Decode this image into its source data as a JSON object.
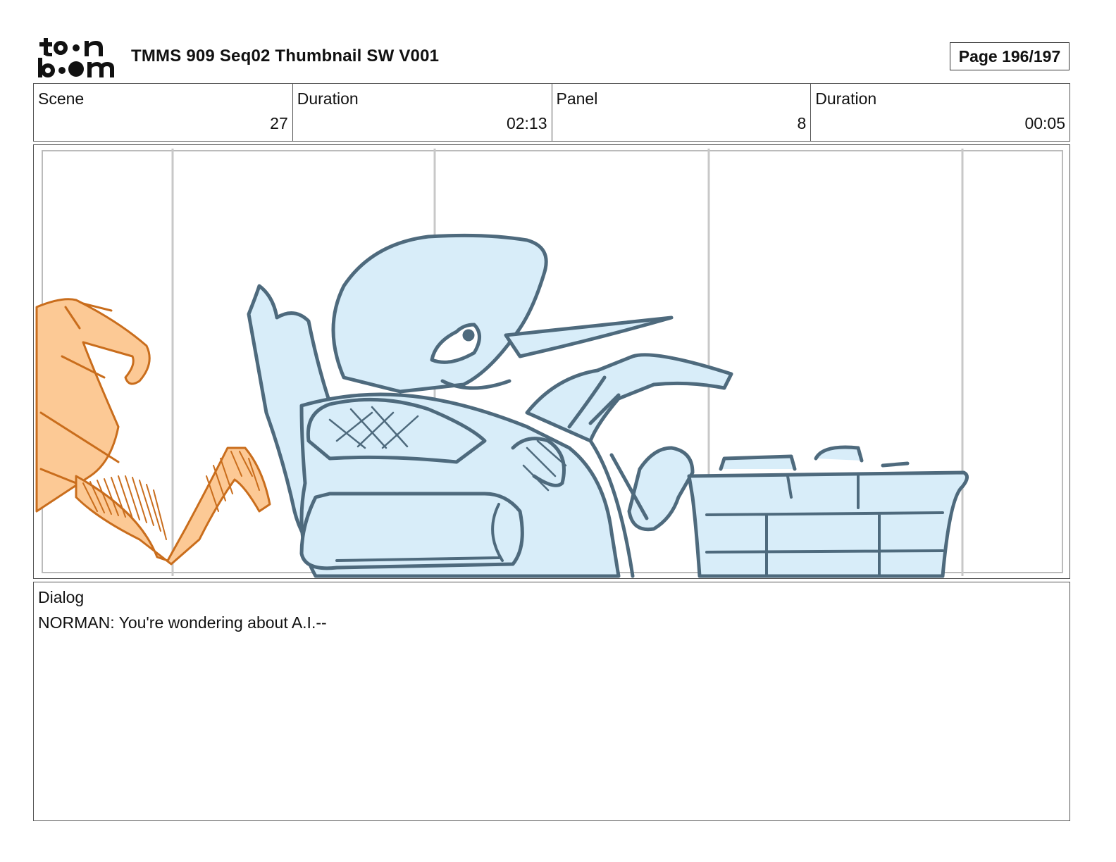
{
  "header": {
    "logo_text": "toonboom",
    "title": "TMMS 909 Seq02 Thumbnail SW V001",
    "page": "Page 196/197"
  },
  "info": {
    "scene_label": "Scene",
    "scene_value": "27",
    "scene_duration_label": "Duration",
    "scene_duration_value": "02:13",
    "panel_label": "Panel",
    "panel_value": "8",
    "panel_duration_label": "Duration",
    "panel_duration_value": "00:05"
  },
  "panel_image": {
    "description_icon": "storyboard-sketch"
  },
  "dialog": {
    "label": "Dialog",
    "text": "NORMAN: You're wondering about A.I.--"
  },
  "colors": {
    "sketch_blue_fill": "#d8edf9",
    "sketch_blue_line": "#4e6a7d",
    "sketch_orange_fill": "#fcc995",
    "sketch_orange_line": "#c96d1c",
    "guide_gray": "#c8c8c8"
  }
}
